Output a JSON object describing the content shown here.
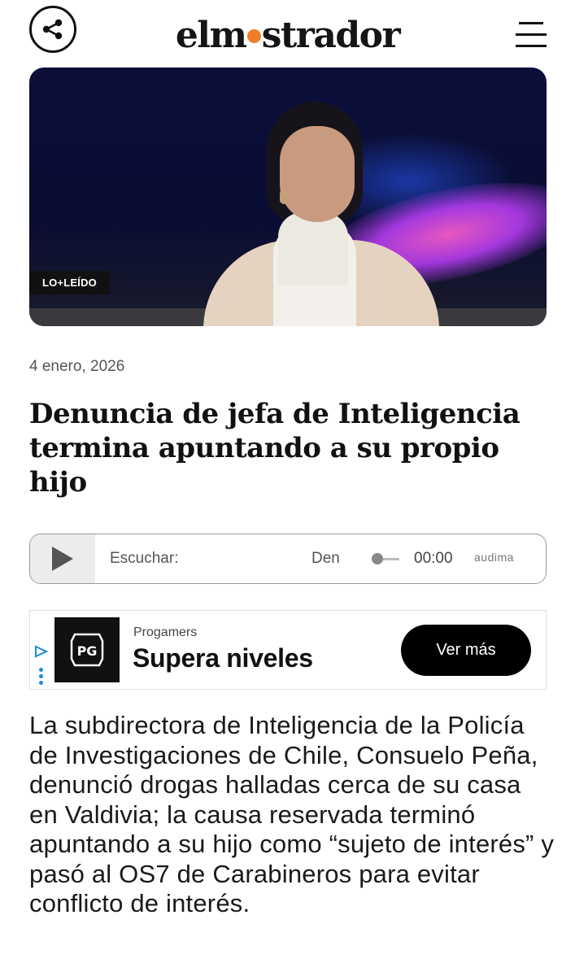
{
  "header": {
    "logo_prefix": "elm",
    "logo_suffix": "strador",
    "share_icon": "share-icon",
    "menu_icon": "hamburger-menu-icon",
    "brand_dot_color": "#ef7d2a"
  },
  "hero": {
    "badge": "LO+LEÍDO"
  },
  "article": {
    "date": "4 enero, 2026",
    "title": "Denuncia de jefa de Inteligencia termina apuntando a su propio hijo",
    "lead": "La subdirectora de Inteligencia de la Policía de Investigaciones de Chile, Consuelo Peña, denunció drogas halladas cerca de su casa en Valdivia; la causa reservada terminó apuntando a su hijo como “sujeto de interés” y pasó al OS7 de Carabineros para evitar conflicto de interés."
  },
  "player": {
    "play_icon": "play-icon",
    "listen_label": "Escuchar:",
    "track_title": "Den",
    "time": "00:00",
    "brand": "audima"
  },
  "ad": {
    "advertiser": "Progamers",
    "headline": "Supera niveles",
    "cta": "Ver más",
    "logo_text": "PG"
  }
}
